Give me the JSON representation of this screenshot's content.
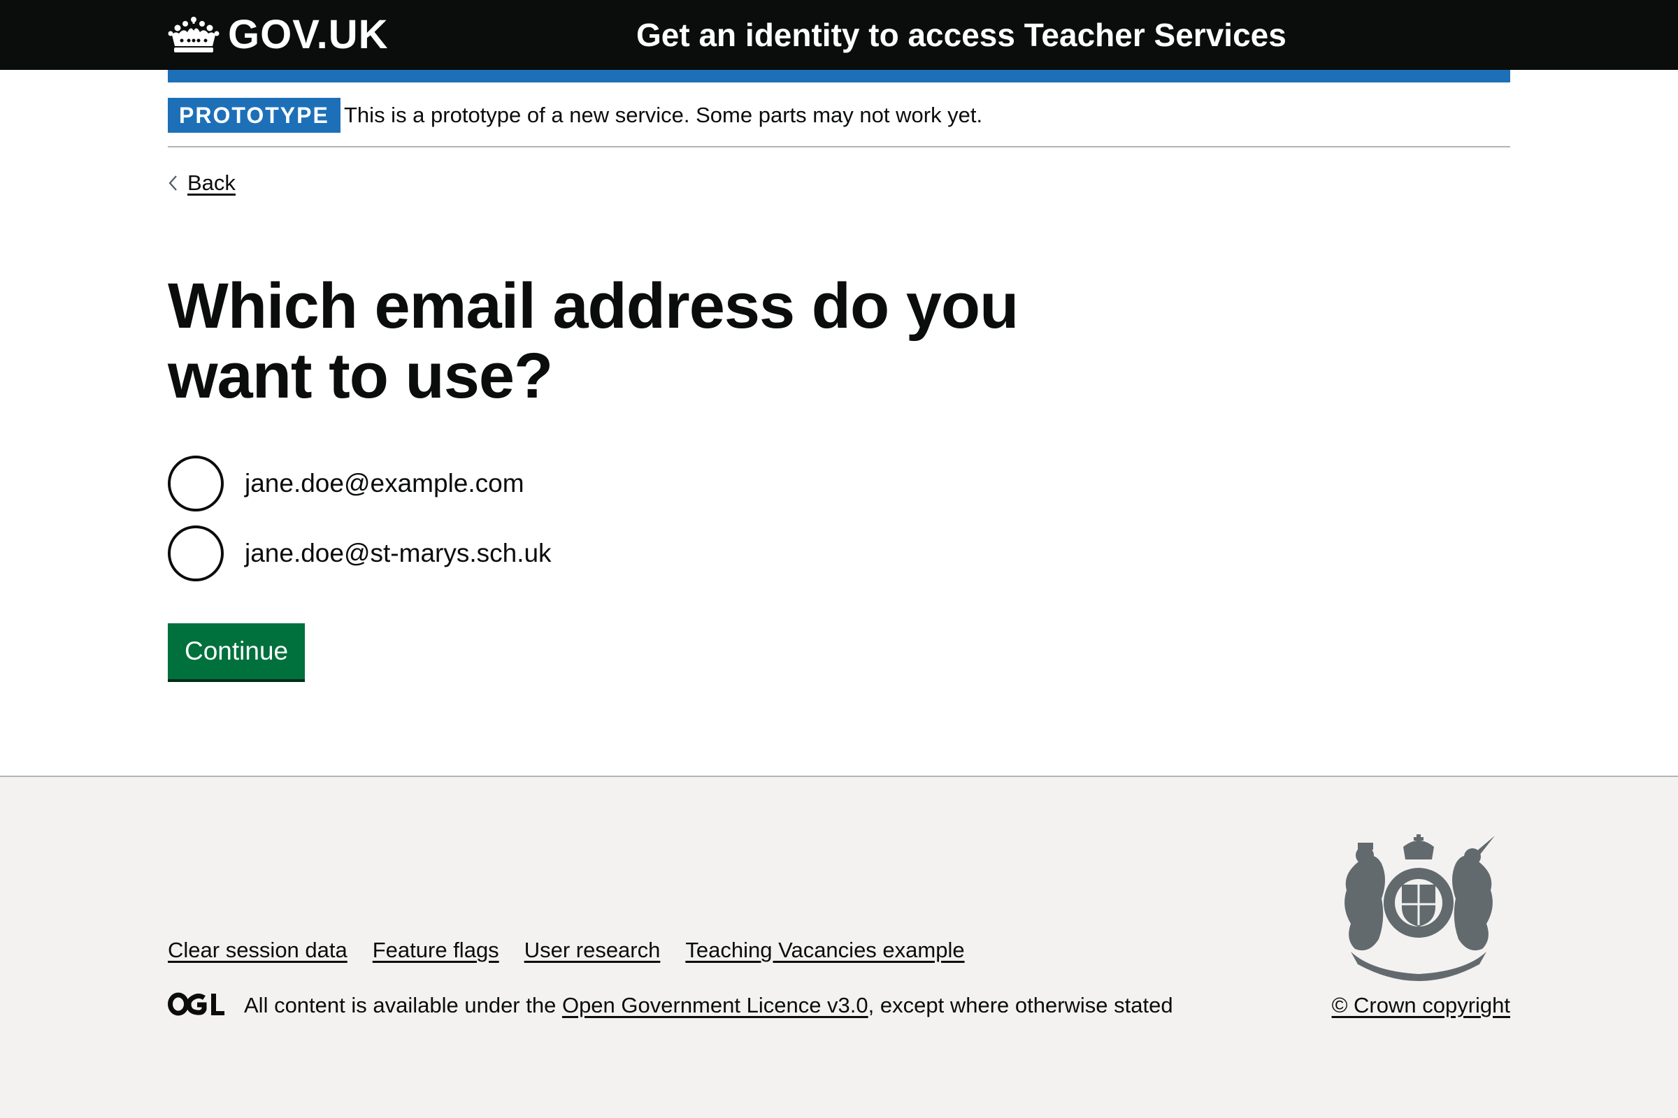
{
  "header": {
    "logo_text": "GOV.UK",
    "service_name": "Get an identity to access Teacher Services"
  },
  "phase_banner": {
    "tag": "PROTOTYPE",
    "text": "This is a prototype of a new service. Some parts may not work yet."
  },
  "back_link": "Back",
  "main": {
    "title": "Which email address do you want to use?",
    "options": [
      {
        "label": "jane.doe@example.com",
        "selected": false
      },
      {
        "label": "jane.doe@st-marys.sch.uk",
        "selected": false
      }
    ],
    "continue_label": "Continue"
  },
  "footer": {
    "links": [
      "Clear session data",
      "Feature flags",
      "User research",
      "Teaching Vacancies example"
    ],
    "licence_prefix": "All content is available under the ",
    "licence_link": "Open Government Licence v3.0",
    "licence_suffix": ", except where otherwise stated",
    "copyright": "© Crown copyright"
  },
  "colors": {
    "header_bg": "#0b0c0c",
    "brand_blue": "#1d70b8",
    "button_green": "#00703c",
    "footer_bg": "#f3f2f1"
  }
}
